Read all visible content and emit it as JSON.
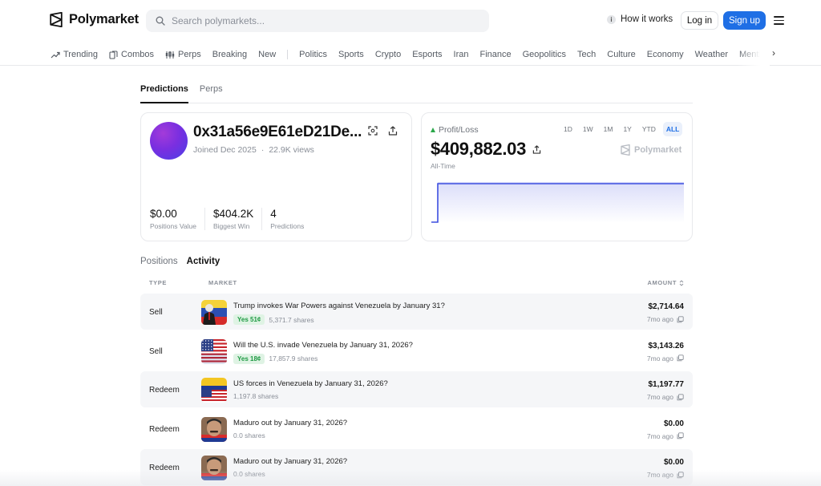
{
  "header": {
    "brand": "Polymarket",
    "search_placeholder": "Search polymarkets...",
    "how_it_works": "How it works",
    "login": "Log in",
    "signup": "Sign up"
  },
  "nav": {
    "items": [
      {
        "label": "Trending",
        "icon": "trending-icon"
      },
      {
        "label": "Combos",
        "icon": "combos-icon"
      },
      {
        "label": "Perps",
        "icon": "perps-icon"
      },
      {
        "label": "Breaking"
      },
      {
        "label": "New"
      },
      {
        "label": "Politics"
      },
      {
        "label": "Sports"
      },
      {
        "label": "Crypto"
      },
      {
        "label": "Esports"
      },
      {
        "label": "Iran"
      },
      {
        "label": "Finance"
      },
      {
        "label": "Geopolitics"
      },
      {
        "label": "Tech"
      },
      {
        "label": "Culture"
      },
      {
        "label": "Economy"
      },
      {
        "label": "Weather"
      },
      {
        "label": "Mentio"
      }
    ]
  },
  "profile_tabs": [
    "Predictions",
    "Perps"
  ],
  "profile": {
    "wallet": "0x31a56e9E61eD21De...",
    "joined": "Joined Dec 2025",
    "views": "22.9K views",
    "stats": [
      {
        "value": "$0.00",
        "label": "Positions Value"
      },
      {
        "value": "$404.2K",
        "label": "Biggest Win"
      },
      {
        "value": "4",
        "label": "Predictions"
      }
    ]
  },
  "pnl": {
    "title": "Profit/Loss",
    "value": "$409,882.03",
    "period": "All-Time",
    "brand": "Polymarket",
    "ranges": [
      "1D",
      "1W",
      "1M",
      "1Y",
      "YTD",
      "ALL"
    ],
    "active_range": "ALL",
    "accent": "#3d4fe0"
  },
  "activity_tabs": [
    "Positions",
    "Activity"
  ],
  "table": {
    "headers": {
      "type": "TYPE",
      "market": "MARKET",
      "amount": "AMOUNT"
    },
    "rows": [
      {
        "type": "Sell",
        "title": "Trump invokes War Powers against Venezuela by January 31?",
        "badge": "Yes 51¢",
        "shares": "5,371.7 shares",
        "amount": "$2,714.64",
        "time": "7mo ago",
        "thumb": "trump"
      },
      {
        "type": "Sell",
        "title": "Will the U.S. invade Venezuela by January 31, 2026?",
        "badge": "Yes 18¢",
        "shares": "17,857.9 shares",
        "amount": "$3,143.26",
        "time": "7mo ago",
        "thumb": "usflag"
      },
      {
        "type": "Redeem",
        "title": "US forces in Venezuela by January 31, 2026?",
        "badge": "",
        "shares": "1,197.8 shares",
        "amount": "$1,197.77",
        "time": "7mo ago",
        "thumb": "usvenflag"
      },
      {
        "type": "Redeem",
        "title": "Maduro out by January 31, 2026?",
        "badge": "",
        "shares": "0.0 shares",
        "amount": "$0.00",
        "time": "7mo ago",
        "thumb": "maduro"
      },
      {
        "type": "Redeem",
        "title": "Maduro out by January 31, 2026?",
        "badge": "",
        "shares": "0.0 shares",
        "amount": "$0.00",
        "time": "7mo ago",
        "thumb": "maduro"
      }
    ]
  },
  "colors": {
    "accent_blue": "#1f6fe5",
    "positive_green": "#1f9a44",
    "row_shade": "#f5f6f8"
  }
}
